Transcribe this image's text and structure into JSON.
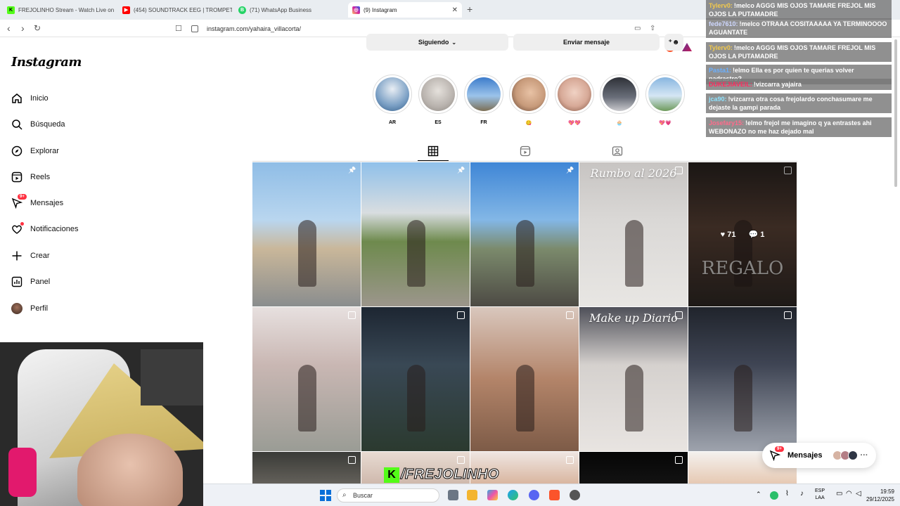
{
  "browser": {
    "tabs": [
      {
        "title": "FREJOLINHO Stream - Watch Live on",
        "favicon_color": "#53fc18",
        "favicon_char": "K"
      },
      {
        "title": "(454) SOUNDTRACK EEG | TROMPETA",
        "favicon_color": "#ff0000",
        "favicon_char": "▶"
      },
      {
        "title": "(71) WhatsApp Business",
        "favicon_color": "#25d366",
        "favicon_char": "B"
      },
      {
        "title": "(9) Instagram",
        "favicon_color": "#d6249f",
        "favicon_char": "◎"
      }
    ],
    "url": "instagram.com/yahaira_villacorta/"
  },
  "instagram": {
    "logo": "Instagram",
    "nav": [
      {
        "label": "Inicio",
        "icon": "home-icon"
      },
      {
        "label": "Búsqueda",
        "icon": "search-icon"
      },
      {
        "label": "Explorar",
        "icon": "compass-icon"
      },
      {
        "label": "Reels",
        "icon": "reels-icon"
      },
      {
        "label": "Mensajes",
        "icon": "messenger-icon",
        "badge": "9+"
      },
      {
        "label": "Notificaciones",
        "icon": "heart-icon"
      },
      {
        "label": "Crear",
        "icon": "plus-icon"
      },
      {
        "label": "Panel",
        "icon": "dashboard-icon"
      },
      {
        "label": "Perfil",
        "icon": "avatar-icon"
      }
    ],
    "profile": {
      "following_label": "Siguiendo",
      "message_label": "Enviar mensaje"
    },
    "highlights": [
      {
        "label": "AR",
        "color": "#7a9fc4"
      },
      {
        "label": "ES",
        "color": "#b8b2ad"
      },
      {
        "label": "FR",
        "color": "#5b8cc9"
      },
      {
        "label": "😋",
        "color": "#c79a7a"
      },
      {
        "label": "💖💖",
        "color": "#d7a997"
      },
      {
        "label": "🧁",
        "color": "#6a6f7a"
      },
      {
        "label": "💖💗",
        "color": "#88b6e0"
      }
    ],
    "posts": [
      {
        "kind": "pin",
        "bg": "linear-gradient(180deg,#8fbde6 0%,#b9d6ef 40%,#c9b79a 60%,#8a8d8e 100%)"
      },
      {
        "kind": "pin",
        "bg": "linear-gradient(180deg,#8fc0ea 0%,#d8dde0 35%,#6e8a4d 55%,#9c968c 100%)"
      },
      {
        "kind": "pin",
        "bg": "linear-gradient(180deg,#3f86d6 0%,#83b7e6 40%,#7b8a6c 60%,#4d4a44 100%)"
      },
      {
        "kind": "reel",
        "bg": "linear-gradient(180deg,#c7c4c2 0%,#dad8d6 40%,#e8e6e3 100%)",
        "caption": "Rumbo al 2026"
      },
      {
        "kind": "reel",
        "bg": "linear-gradient(180deg,#2a2320 0%,#5a4236 45%,#2f2824 100%)",
        "caption": "REGALO",
        "likes": "71",
        "comments": "1"
      },
      {
        "kind": "reel",
        "bg": "linear-gradient(180deg,#e7e0df 0%,#c9b7b3 40%,#9a9c95 100%)"
      },
      {
        "kind": "reel",
        "bg": "linear-gradient(180deg,#1d2632 0%,#394855 40%,#2b3a2f 100%)"
      },
      {
        "kind": "reel",
        "bg": "linear-gradient(180deg,#d9c7bd 0%,#b38469 50%,#7d5b47 100%)"
      },
      {
        "kind": "reel",
        "bg": "linear-gradient(180deg,#4e4f58 0%,#d5d1ce 40%,#e8e4e1 100%)",
        "caption": "Make up Diario"
      },
      {
        "kind": "reel",
        "bg": "linear-gradient(180deg,#20242c 0%,#3f4554 40%,#9ea3ad 100%)"
      },
      {
        "kind": "reel",
        "bg": "linear-gradient(180deg,#3a3b37 0%,#63605a 100%)"
      },
      {
        "kind": "reel",
        "bg": "linear-gradient(180deg,#e8dbd2 0%,#cfb9ad 100%)"
      },
      {
        "kind": "reel",
        "bg": "linear-gradient(180deg,#efe6e2 0%,#d9b6a0 100%)"
      },
      {
        "kind": "reel",
        "bg": "linear-gradient(180deg,#060606 0%,#121212 100%)"
      },
      {
        "kind": "reel",
        "bg": "linear-gradient(180deg,#f4f1ee 0%,#e6c9b3 100%)"
      }
    ],
    "messages_pill": {
      "label": "Mensajes",
      "badge": "9+"
    }
  },
  "chat": [
    {
      "user": "Tylerv0:",
      "user_color": "#f2c94c",
      "text": "!melco AGGG MIS OJOS TAMARE FREJOL MIS OJOS LA PUTAMADRE"
    },
    {
      "user": "fede7610:",
      "user_color": "#cfd8ff",
      "text": "!melco OTRAAA COSITAAAAA YA TERMINOOOO AGUANTATE"
    },
    {
      "user": "Tylerv0:",
      "user_color": "#f2c94c",
      "text": "!melco AGGG MIS OJOS TAMARE FREJOL MIS OJOS LA PUTAMADRE"
    },
    {
      "user": "Pasta1:",
      "user_color": "#6ab0ff",
      "text": "!elmo Ella es por quien te querias volver padrastro?"
    },
    {
      "user": "DUKEJIAVEIL:",
      "user_color": "#ff2a5e",
      "text": "!vizcarra yajaira"
    },
    {
      "user": "jca90:",
      "user_color": "#8ee3ff",
      "text": "!vizcarra otra cosa frejolardo conchasumare me dejaste la gampi parada"
    },
    {
      "user": "Josefary15:",
      "user_color": "#ff6b8b",
      "text": "!elmo frejol me imagino q ya entrastes ahi WEBONAZO no me haz dejado mal"
    }
  ],
  "stream": {
    "watermark": "/FREJOLINHO"
  },
  "taskbar": {
    "search_placeholder": "Buscar",
    "lang_top": "ESP",
    "lang_bottom": "LAA",
    "time": "19:59",
    "date": "29/12/2025"
  }
}
